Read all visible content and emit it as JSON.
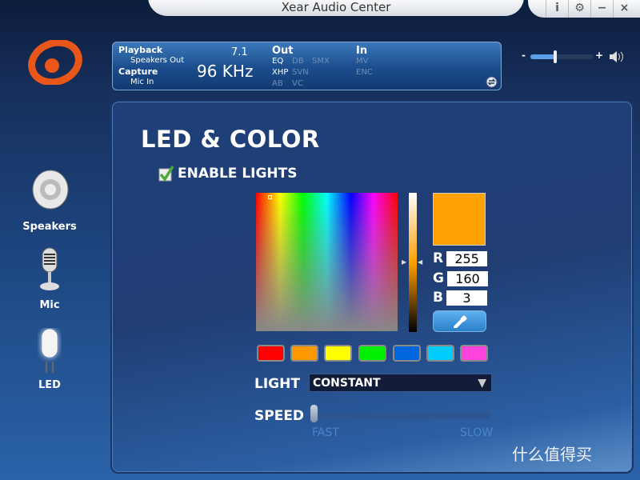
{
  "window": {
    "title": "Xear Audio Center",
    "buttons": [
      "i",
      "⚙",
      "−",
      "×"
    ]
  },
  "info": {
    "playback_label": "Playback",
    "playback_device": "Speakers Out",
    "capture_label": "Capture",
    "capture_device": "Mic In",
    "channels": "7.1",
    "sample_rate": "96 KHz",
    "out_label": "Out",
    "out_items": [
      {
        "label": "EQ",
        "active": true
      },
      {
        "label": "DB",
        "active": false
      },
      {
        "label": "SMX",
        "active": false
      },
      {
        "label": "XHP",
        "active": true
      },
      {
        "label": "SVN",
        "active": false
      },
      {
        "label": "AB",
        "active": false
      },
      {
        "label": "VC",
        "active": false
      }
    ],
    "in_label": "In",
    "in_items": [
      {
        "label": "MV",
        "active": false
      },
      {
        "label": "ENC",
        "active": false
      }
    ]
  },
  "volume": {
    "minus": "-",
    "plus": "+",
    "level": 0.4
  },
  "sidebar": {
    "items": [
      {
        "label": "Speakers",
        "icon": "speaker-icon"
      },
      {
        "label": "Mic",
        "icon": "microphone-icon"
      },
      {
        "label": "LED",
        "icon": "led-icon",
        "active": true
      }
    ]
  },
  "main": {
    "title": "LED & COLOR",
    "enable_lights": {
      "label": "ENABLE LIGHTS",
      "checked": true
    },
    "color": {
      "hex": "#ffa003",
      "r": "255",
      "g": "160",
      "b": "3",
      "r_label": "R",
      "g_label": "G",
      "b_label": "B"
    },
    "presets": [
      "#ff0000",
      "#ff9900",
      "#ffff00",
      "#00ee00",
      "#0066dd",
      "#00ccff",
      "#ff44dd"
    ],
    "light_label": "LIGHT",
    "light_mode": "CONSTANT",
    "speed_label": "SPEED",
    "speed_fast": "FAST",
    "speed_slow": "SLOW",
    "speed_value": 0
  },
  "watermark": "什么值得买"
}
